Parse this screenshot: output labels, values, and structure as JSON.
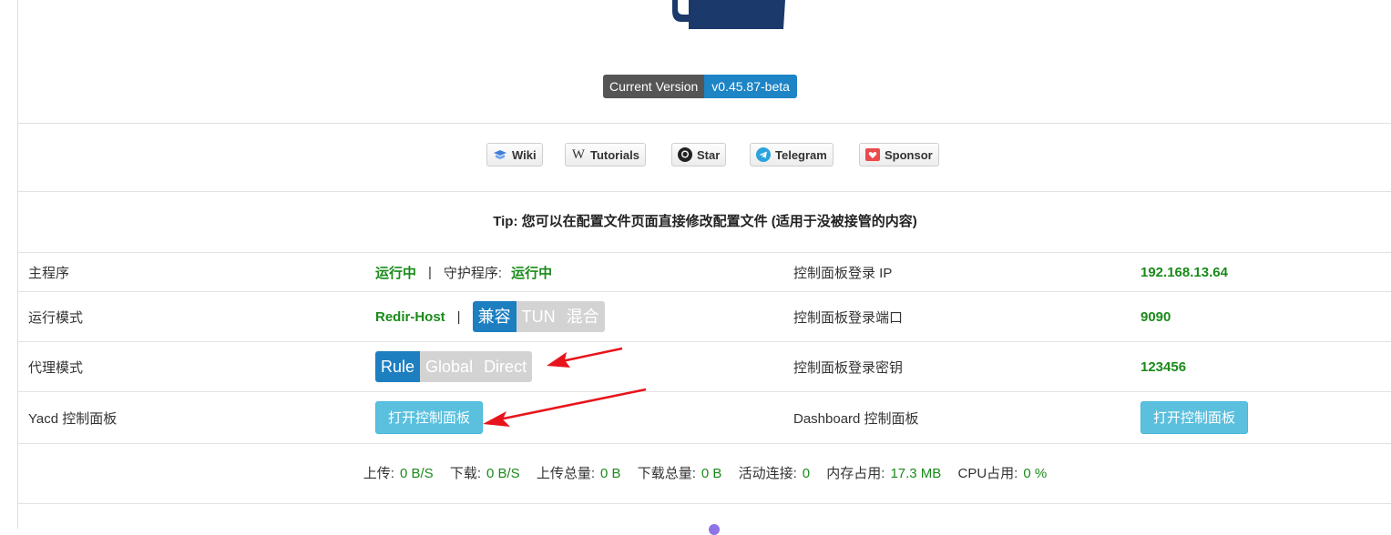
{
  "version": {
    "label": "Current Version",
    "value": "v0.45.87-beta"
  },
  "links": [
    {
      "label": "Wiki",
      "icon": "book-icon"
    },
    {
      "label": "Tutorials",
      "icon": "wikipedia-icon"
    },
    {
      "label": "Star",
      "icon": "github-icon"
    },
    {
      "label": "Telegram",
      "icon": "telegram-icon"
    },
    {
      "label": "Sponsor",
      "icon": "sponsor-icon"
    }
  ],
  "tip": "Tip: 您可以在配置文件页面直接修改配置文件 (适用于没被接管的内容)",
  "rows": {
    "main": {
      "label": "主程序",
      "status": "运行中",
      "daemon_label": "守护程序:",
      "daemon_status": "运行中",
      "right_label": "控制面板登录 IP",
      "right_value": "192.168.13.64"
    },
    "run_mode": {
      "label": "运行模式",
      "value": "Redir-Host",
      "options": [
        "兼容",
        "TUN",
        "混合"
      ],
      "selected": "兼容",
      "right_label": "控制面板登录端口",
      "right_value": "9090"
    },
    "proxy_mode": {
      "label": "代理模式",
      "options": [
        "Rule",
        "Global",
        "Direct"
      ],
      "selected": "Rule",
      "right_label": "控制面板登录密钥",
      "right_value": "123456"
    },
    "panel": {
      "label": "Yacd 控制面板",
      "button": "打开控制面板",
      "right_label": "Dashboard 控制面板",
      "right_button": "打开控制面板"
    }
  },
  "stats": [
    {
      "label": "上传:",
      "value": "0 B/S"
    },
    {
      "label": "下载:",
      "value": "0 B/S"
    },
    {
      "label": "上传总量:",
      "value": "0 B"
    },
    {
      "label": "下载总量:",
      "value": "0 B"
    },
    {
      "label": "活动连接:",
      "value": "0"
    },
    {
      "label": "内存占用:",
      "value": "17.3 MB"
    },
    {
      "label": "CPU占用:",
      "value": "0 %"
    }
  ],
  "colors": {
    "accent": "#1d7fc0",
    "status_green": "#1a8a1a",
    "button_info": "#5bc0de",
    "arrow": "#e8141b"
  }
}
